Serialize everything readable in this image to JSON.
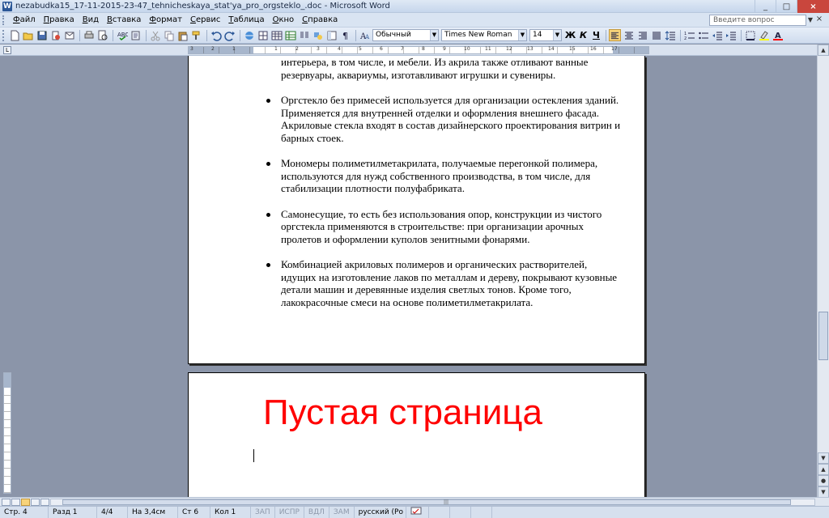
{
  "window": {
    "title": "nezabudka15_17-11-2015-23-47_tehnicheskaya_stat'ya_pro_orgsteklo_.doc - Microsoft Word",
    "min": "_",
    "max": "□",
    "close": "×"
  },
  "menu": {
    "items": [
      "Файл",
      "Правка",
      "Вид",
      "Вставка",
      "Формат",
      "Сервис",
      "Таблица",
      "Окно",
      "Справка"
    ],
    "ask_placeholder": "Введите вопрос",
    "ask_arrow": "▼",
    "doc_close": "×"
  },
  "toolbar": {
    "style": "Обычный",
    "font": "Times New Roman",
    "size": "14",
    "bold": "Ж",
    "italic": "К",
    "underline": "Ч"
  },
  "ruler": {
    "tab_selector": "L",
    "numbers": [
      "3",
      "2",
      "1",
      "1",
      "2",
      "3",
      "4",
      "5",
      "6",
      "7",
      "8",
      "9",
      "10",
      "11",
      "12",
      "13",
      "14",
      "15",
      "16",
      "17"
    ]
  },
  "document": {
    "top_lines": [
      "интерьера, в том числе, и мебели. Из акрила также отливают ванные",
      "резервуары, аквариумы, изготавливают игрушки и сувениры."
    ],
    "bullets": [
      "Оргстекло без примесей используется для организации остекления зданий. Применяется для внутренней отделки и оформления внешнего фасада. Акриловые стекла входят в состав дизайнерского проектирования витрин и барных стоек.",
      "Мономеры полиметилметакрилата, получаемые перегонкой полимера, используются для нужд собственного производства, в том числе, для стабилизации плотности полуфабриката.",
      "Самонесущие, то есть без использования опор, конструкции из чистого оргстекла применяются в строительстве: при организации арочных пролетов и оформлении куполов зенитными фонарями.",
      "Комбинацией акриловых полимеров и органических растворителей, идущих на изготовление лаков по металлам и дереву, покрывают кузовные детали машин и деревянные изделия светлых тонов. Кроме того, лакокрасочные смеси на основе полиметилметакрилата."
    ],
    "page2_heading": "Пустая страница",
    "heading_color": "#ff0000"
  },
  "status": {
    "page": "Стр. 4",
    "section": "Разд 1",
    "pages": "4/4",
    "at": "На 3,4см",
    "line": "Ст 6",
    "col": "Кол 1",
    "rec": "ЗАП",
    "trk": "ИСПР",
    "ext": "ВДЛ",
    "ovr": "ЗАМ",
    "language": "русский (Ро"
  },
  "scroll": {
    "up": "▲",
    "down": "▼",
    "grip": "|||"
  }
}
